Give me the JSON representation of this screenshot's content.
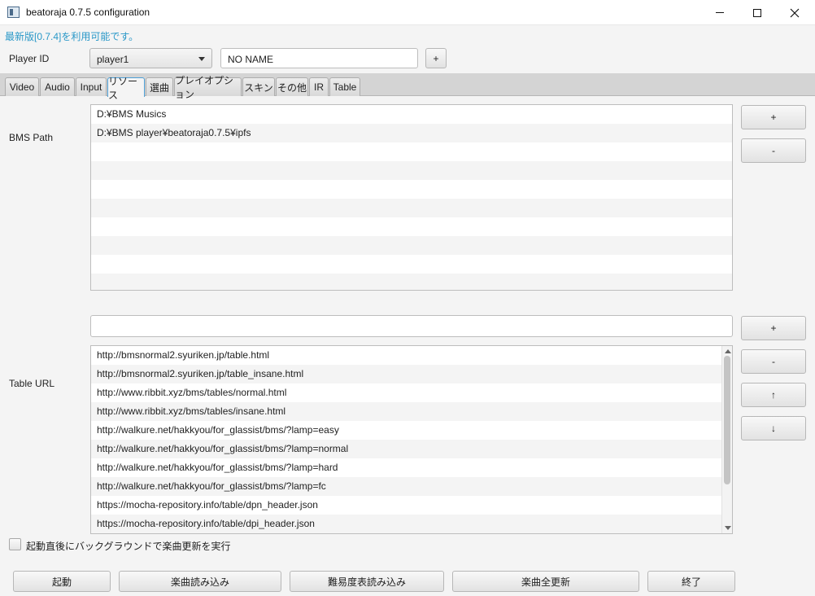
{
  "window": {
    "title": "beatoraja 0.7.5 configuration"
  },
  "notice": "最新版[0.7.4]を利用可能です。",
  "player": {
    "label": "Player ID",
    "selected": "player1",
    "name_value": "NO NAME",
    "add_label": "+"
  },
  "tabs": [
    {
      "label": "Video"
    },
    {
      "label": "Audio"
    },
    {
      "label": "Input"
    },
    {
      "label": "リソース"
    },
    {
      "label": "選曲"
    },
    {
      "label": "プレイオプション"
    },
    {
      "label": "スキン"
    },
    {
      "label": "その他"
    },
    {
      "label": "IR"
    },
    {
      "label": "Table"
    }
  ],
  "active_tab": "リソース",
  "bms_path": {
    "label": "BMS Path",
    "items": [
      "D:¥BMS Musics",
      "D:¥BMS player¥beatoraja0.7.5¥ipfs"
    ],
    "add_label": "+",
    "remove_label": "-"
  },
  "table_url": {
    "label": "Table URL",
    "input_value": "",
    "items": [
      "http://bmsnormal2.syuriken.jp/table.html",
      "http://bmsnormal2.syuriken.jp/table_insane.html",
      "http://www.ribbit.xyz/bms/tables/normal.html",
      "http://www.ribbit.xyz/bms/tables/insane.html",
      "http://walkure.net/hakkyou/for_glassist/bms/?lamp=easy",
      "http://walkure.net/hakkyou/for_glassist/bms/?lamp=normal",
      "http://walkure.net/hakkyou/for_glassist/bms/?lamp=hard",
      "http://walkure.net/hakkyou/for_glassist/bms/?lamp=fc",
      "https://mocha-repository.info/table/dpn_header.json",
      "https://mocha-repository.info/table/dpi_header.json"
    ],
    "add_label": "+",
    "remove_label": "-",
    "up_label": "↑",
    "down_label": "↓"
  },
  "background_update": {
    "label": "起動直後にバックグラウンドで楽曲更新を実行",
    "checked": false
  },
  "footer": {
    "start": "起動",
    "load_songs": "楽曲読み込み",
    "load_tables": "難易度表読み込み",
    "update_all": "楽曲全更新",
    "exit": "終了"
  }
}
